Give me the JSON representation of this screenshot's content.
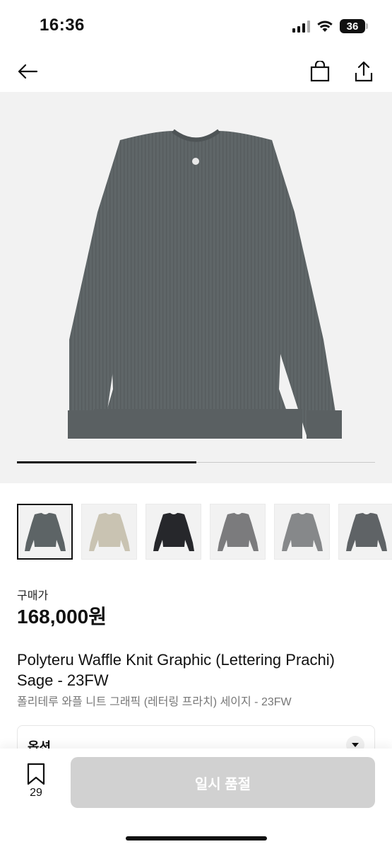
{
  "status_bar": {
    "time": "16:36",
    "battery": "36"
  },
  "product": {
    "price_label": "구매가",
    "price": "168,000원",
    "title_en": "Polyteru Waffle Knit Graphic (Lettering Prachi) Sage - 23FW",
    "title_ko": "폴리테루 와플 니트 그래픽 (레터링 프라치) 세이지 - 23FW"
  },
  "gallery": {
    "progress": 0.5,
    "thumbnails": [
      {
        "name": "sage",
        "color": "#5d6466"
      },
      {
        "name": "beige",
        "color": "#c9c3b2"
      },
      {
        "name": "black",
        "color": "#26272b"
      },
      {
        "name": "gray",
        "color": "#7b7b7d"
      },
      {
        "name": "gray-graphic",
        "color": "#86888a"
      },
      {
        "name": "charcoal-graphic",
        "color": "#5f6366"
      }
    ]
  },
  "options": {
    "label": "옵션"
  },
  "bottom_bar": {
    "wish_count": "29",
    "cta_label": "일시 품절"
  },
  "icons": [
    "back-arrow-icon",
    "shopping-bag-icon",
    "share-icon",
    "bookmark-icon",
    "chevron-down-icon"
  ]
}
